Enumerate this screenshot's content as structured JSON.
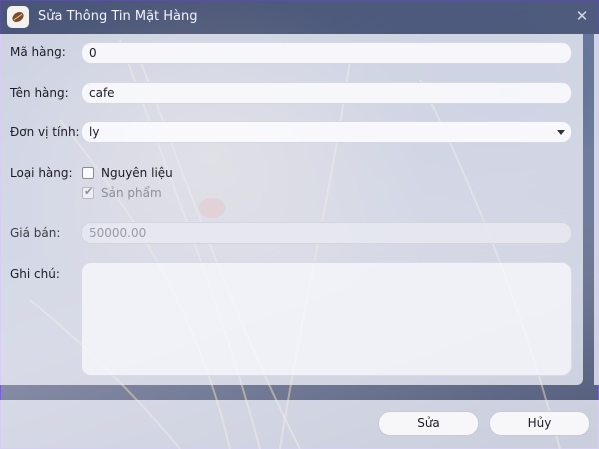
{
  "window": {
    "title": "Sửa Thông Tin Mặt Hàng",
    "close_label": "✕",
    "app_icon": "coffee-bean-icon"
  },
  "form": {
    "ma_hang": {
      "label": "Mã hàng:",
      "value": "0"
    },
    "ten_hang": {
      "label": "Tên hàng:",
      "value": "cafe"
    },
    "don_vi_tinh": {
      "label": "Đơn vị tính:",
      "selected": "ly"
    },
    "loai_hang": {
      "label": "Loại hàng:",
      "options": [
        {
          "label": "Nguyên liệu",
          "checked": false,
          "enabled": true
        },
        {
          "label": "Sản phẩm",
          "checked": true,
          "enabled": false
        }
      ]
    },
    "gia_ban": {
      "label": "Giá bán:",
      "value": "50000.00"
    },
    "ghi_chu": {
      "label": "Ghi chú:",
      "value": ""
    }
  },
  "buttons": {
    "save": "Sửa",
    "cancel": "Hủy"
  },
  "colors": {
    "accent_border": "#7b5fe0",
    "panel": "#eef0f8"
  }
}
